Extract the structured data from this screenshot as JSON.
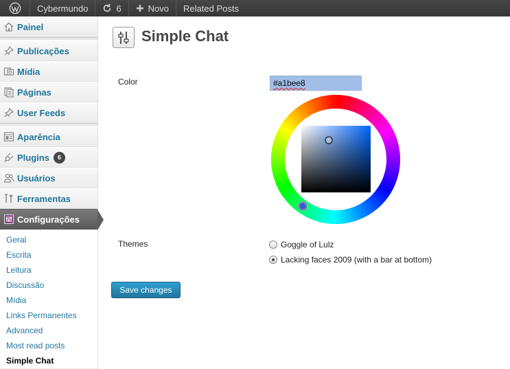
{
  "adminbar": {
    "site_name": "Cybermundo",
    "updates_count": "6",
    "new_label": "Novo",
    "related_label": "Related Posts"
  },
  "sidebar": {
    "items": [
      {
        "label": "Painel",
        "icon": "home-icon"
      },
      {
        "label": "Publicações",
        "icon": "pushpin-icon"
      },
      {
        "label": "Mídia",
        "icon": "media-icon"
      },
      {
        "label": "Páginas",
        "icon": "pages-icon"
      },
      {
        "label": "User Feeds",
        "icon": "pushpin-icon"
      },
      {
        "label": "Aparência",
        "icon": "appearance-icon"
      },
      {
        "label": "Plugins",
        "icon": "plug-icon",
        "badge": "6"
      },
      {
        "label": "Usuários",
        "icon": "users-icon"
      },
      {
        "label": "Ferramentas",
        "icon": "tools-icon"
      },
      {
        "label": "Configurações",
        "icon": "settings-icon"
      }
    ],
    "submenu": [
      "Geral",
      "Escrita",
      "Leitura",
      "Discussão",
      "Mídia",
      "Links Permanentes",
      "Advanced",
      "Most read posts",
      "Simple Chat"
    ]
  },
  "page": {
    "title": "Simple Chat",
    "color_label": "Color",
    "color_value": "#a1bee8",
    "themes_label": "Themes",
    "themes": [
      {
        "label": "Goggle of Lulz",
        "checked": false
      },
      {
        "label": "Lacking faces 2009 (with a bar at bottom)",
        "checked": true
      }
    ],
    "save_label": "Save changes"
  },
  "colors": {
    "accent": "#21759b",
    "selected_color": "#a1bee8",
    "current_menu": "#5f5f5f"
  }
}
